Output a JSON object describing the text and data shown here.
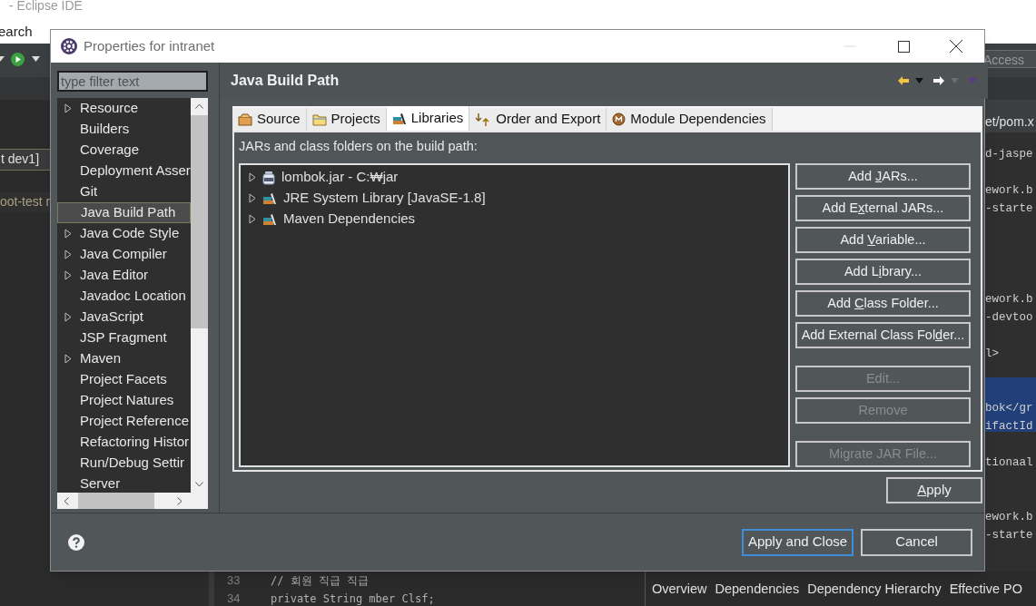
{
  "ide": {
    "title": "- Eclipse IDE",
    "menu": [
      "earch"
    ],
    "quick_access": "Access",
    "editor_tab": "t dev1]",
    "explorer_item": "oot-test r",
    "pom_tab": "et/pom.x",
    "code_blocks": [
      {
        "selected": false,
        "lines": [
          {
            "kind": "code",
            "text": "d-jaspe"
          },
          {
            "kind": "blank"
          },
          {
            "kind": "code",
            "text": "ework.b"
          },
          {
            "kind": "code",
            "text": "-starte"
          },
          {
            "kind": "blank"
          },
          {
            "kind": "blank"
          },
          {
            "kind": "blank"
          },
          {
            "kind": "blank"
          },
          {
            "kind": "code",
            "text": "ework.b"
          },
          {
            "kind": "code",
            "text": "-devtoo"
          },
          {
            "kind": "blank"
          },
          {
            "kind": "code",
            "text": "l>"
          },
          {
            "kind": "blank"
          }
        ]
      },
      {
        "selected": true,
        "lines": [
          {
            "kind": "blank"
          },
          {
            "kind": "code",
            "text": "bok</gr"
          },
          {
            "kind": "code",
            "text": "ifactId"
          }
        ]
      },
      {
        "selected": false,
        "lines": [
          {
            "kind": "blank"
          },
          {
            "kind": "code",
            "text": "tionaal"
          },
          {
            "kind": "blank"
          },
          {
            "kind": "blank"
          },
          {
            "kind": "code",
            "text": "ework.b"
          },
          {
            "kind": "code",
            "text": "-starte"
          }
        ]
      }
    ],
    "editor_bottom": [
      {
        "number": "33",
        "text": "// 회원 직급 직급"
      },
      {
        "number": "34",
        "text": "private String mber Clsf;"
      }
    ],
    "pom_tabs": [
      "Overview",
      "Dependencies",
      "Dependency Hierarchy",
      "Effective PO"
    ]
  },
  "dialog": {
    "title": "Properties for intranet",
    "filter": {
      "placeholder": "type filter text"
    },
    "tree": [
      {
        "label": "Resource",
        "expandable": true,
        "selected": false
      },
      {
        "label": "Builders",
        "expandable": false,
        "selected": false
      },
      {
        "label": "Coverage",
        "expandable": false,
        "selected": false
      },
      {
        "label": "Deployment Asser",
        "expandable": false,
        "selected": false
      },
      {
        "label": "Git",
        "expandable": false,
        "selected": false
      },
      {
        "label": "Java Build Path",
        "expandable": false,
        "selected": true
      },
      {
        "label": "Java Code Style",
        "expandable": true,
        "selected": false
      },
      {
        "label": "Java Compiler",
        "expandable": true,
        "selected": false
      },
      {
        "label": "Java Editor",
        "expandable": true,
        "selected": false
      },
      {
        "label": "Javadoc Location",
        "expandable": false,
        "selected": false
      },
      {
        "label": "JavaScript",
        "expandable": true,
        "selected": false
      },
      {
        "label": "JSP Fragment",
        "expandable": false,
        "selected": false
      },
      {
        "label": "Maven",
        "expandable": true,
        "selected": false
      },
      {
        "label": "Project Facets",
        "expandable": false,
        "selected": false
      },
      {
        "label": "Project Natures",
        "expandable": false,
        "selected": false
      },
      {
        "label": "Project Reference",
        "expandable": false,
        "selected": false
      },
      {
        "label": "Refactoring Histor",
        "expandable": false,
        "selected": false
      },
      {
        "label": "Run/Debug Settir",
        "expandable": false,
        "selected": false
      },
      {
        "label": "Server",
        "expandable": false,
        "selected": false
      }
    ],
    "page_title": "Java Build Path",
    "tabs": [
      {
        "label": "Source",
        "kind": "source",
        "selected": false
      },
      {
        "label": "Projects",
        "kind": "projects",
        "selected": false
      },
      {
        "label": "Libraries",
        "kind": "libraries",
        "selected": true
      },
      {
        "label": "Order and Export",
        "kind": "order",
        "selected": false
      },
      {
        "label": "Module Dependencies",
        "kind": "module",
        "selected": false
      }
    ],
    "list_label": "JARs and class folders on the build path:",
    "entries": [
      {
        "label": "lombok.jar - C:₩jar",
        "kind": "jar"
      },
      {
        "label": "JRE System Library [JavaSE-1.8]",
        "kind": "library"
      },
      {
        "label": "Maven Dependencies",
        "kind": "library"
      }
    ],
    "button_groups": [
      [
        {
          "before": "Add ",
          "key": "J",
          "after": "ARs...",
          "disabled": false
        },
        {
          "before": "Add E",
          "key": "x",
          "after": "ternal JARs...",
          "disabled": false
        },
        {
          "before": "Add ",
          "key": "V",
          "after": "ariable...",
          "disabled": false
        },
        {
          "before": "Add L",
          "key": "i",
          "after": "brary...",
          "disabled": false
        },
        {
          "before": "Add ",
          "key": "C",
          "after": "lass Folder...",
          "disabled": false
        },
        {
          "before": "Add External Class Fol",
          "key": "d",
          "after": "er...",
          "disabled": false
        }
      ],
      [
        {
          "before": "Edit...",
          "disabled": true
        },
        {
          "before": "Remove",
          "disabled": true
        }
      ],
      [
        {
          "before": "Migrate JAR File...",
          "disabled": true
        }
      ]
    ],
    "apply": {
      "key": "A",
      "after": "pply"
    },
    "footer_buttons": [
      {
        "label": "Apply and Close",
        "default": true
      },
      {
        "label": "Cancel",
        "default": false
      }
    ]
  }
}
